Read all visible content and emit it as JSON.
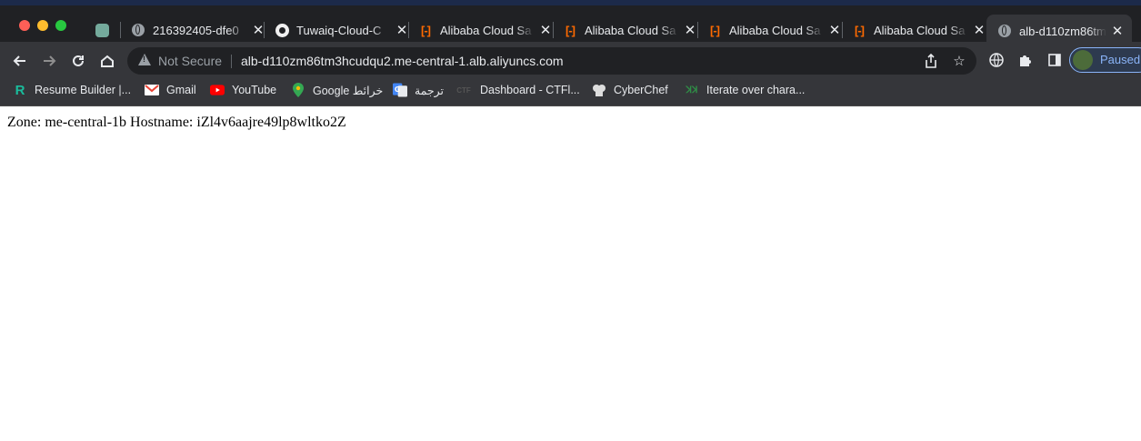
{
  "tabs": [
    {
      "label": "",
      "icon": "chatgpt-icon"
    },
    {
      "label": "216392405-dfe0",
      "icon": "globe-icon"
    },
    {
      "label": "Tuwaiq-Cloud-C",
      "icon": "github-icon"
    },
    {
      "label": "Alibaba Cloud Sa",
      "icon": "alibaba-cloud-icon"
    },
    {
      "label": "Alibaba Cloud Sa",
      "icon": "alibaba-cloud-icon"
    },
    {
      "label": "Alibaba Cloud Sa",
      "icon": "alibaba-cloud-icon"
    },
    {
      "label": "Alibaba Cloud Sa",
      "icon": "alibaba-cloud-icon"
    },
    {
      "label": "alb-d110zm86tm",
      "icon": "globe-icon",
      "active": true
    }
  ],
  "toolbar": {
    "not_secure": "Not Secure",
    "url": "alb-d110zm86tm3hcudqu2.me-central-1.alb.aliyuncs.com",
    "profile_label": "Paused"
  },
  "bookmarks": [
    {
      "label": "Resume Builder |...",
      "icon": "resume-builder-icon",
      "color": "#1abc9c"
    },
    {
      "label": "Gmail",
      "icon": "gmail-icon",
      "color": "#ea4335"
    },
    {
      "label": "YouTube",
      "icon": "youtube-icon",
      "color": "#ff0000"
    },
    {
      "label": "Google خرائط",
      "icon": "google-maps-icon",
      "color": "#34a853"
    },
    {
      "label": "ترجمة",
      "icon": "google-translate-icon",
      "color": "#4285f4"
    },
    {
      "label": "Dashboard - CTFl...",
      "icon": "ctf-icon",
      "color": "#888888"
    },
    {
      "label": "CyberChef",
      "icon": "cyberchef-icon",
      "color": "#dddddd"
    },
    {
      "label": "Iterate over chara...",
      "icon": "geeksforgeeks-icon",
      "color": "#2f8d46"
    }
  ],
  "page": {
    "text": "Zone: me-central-1b Hostname: iZl4v6aajre49lp8wltko2Z"
  }
}
